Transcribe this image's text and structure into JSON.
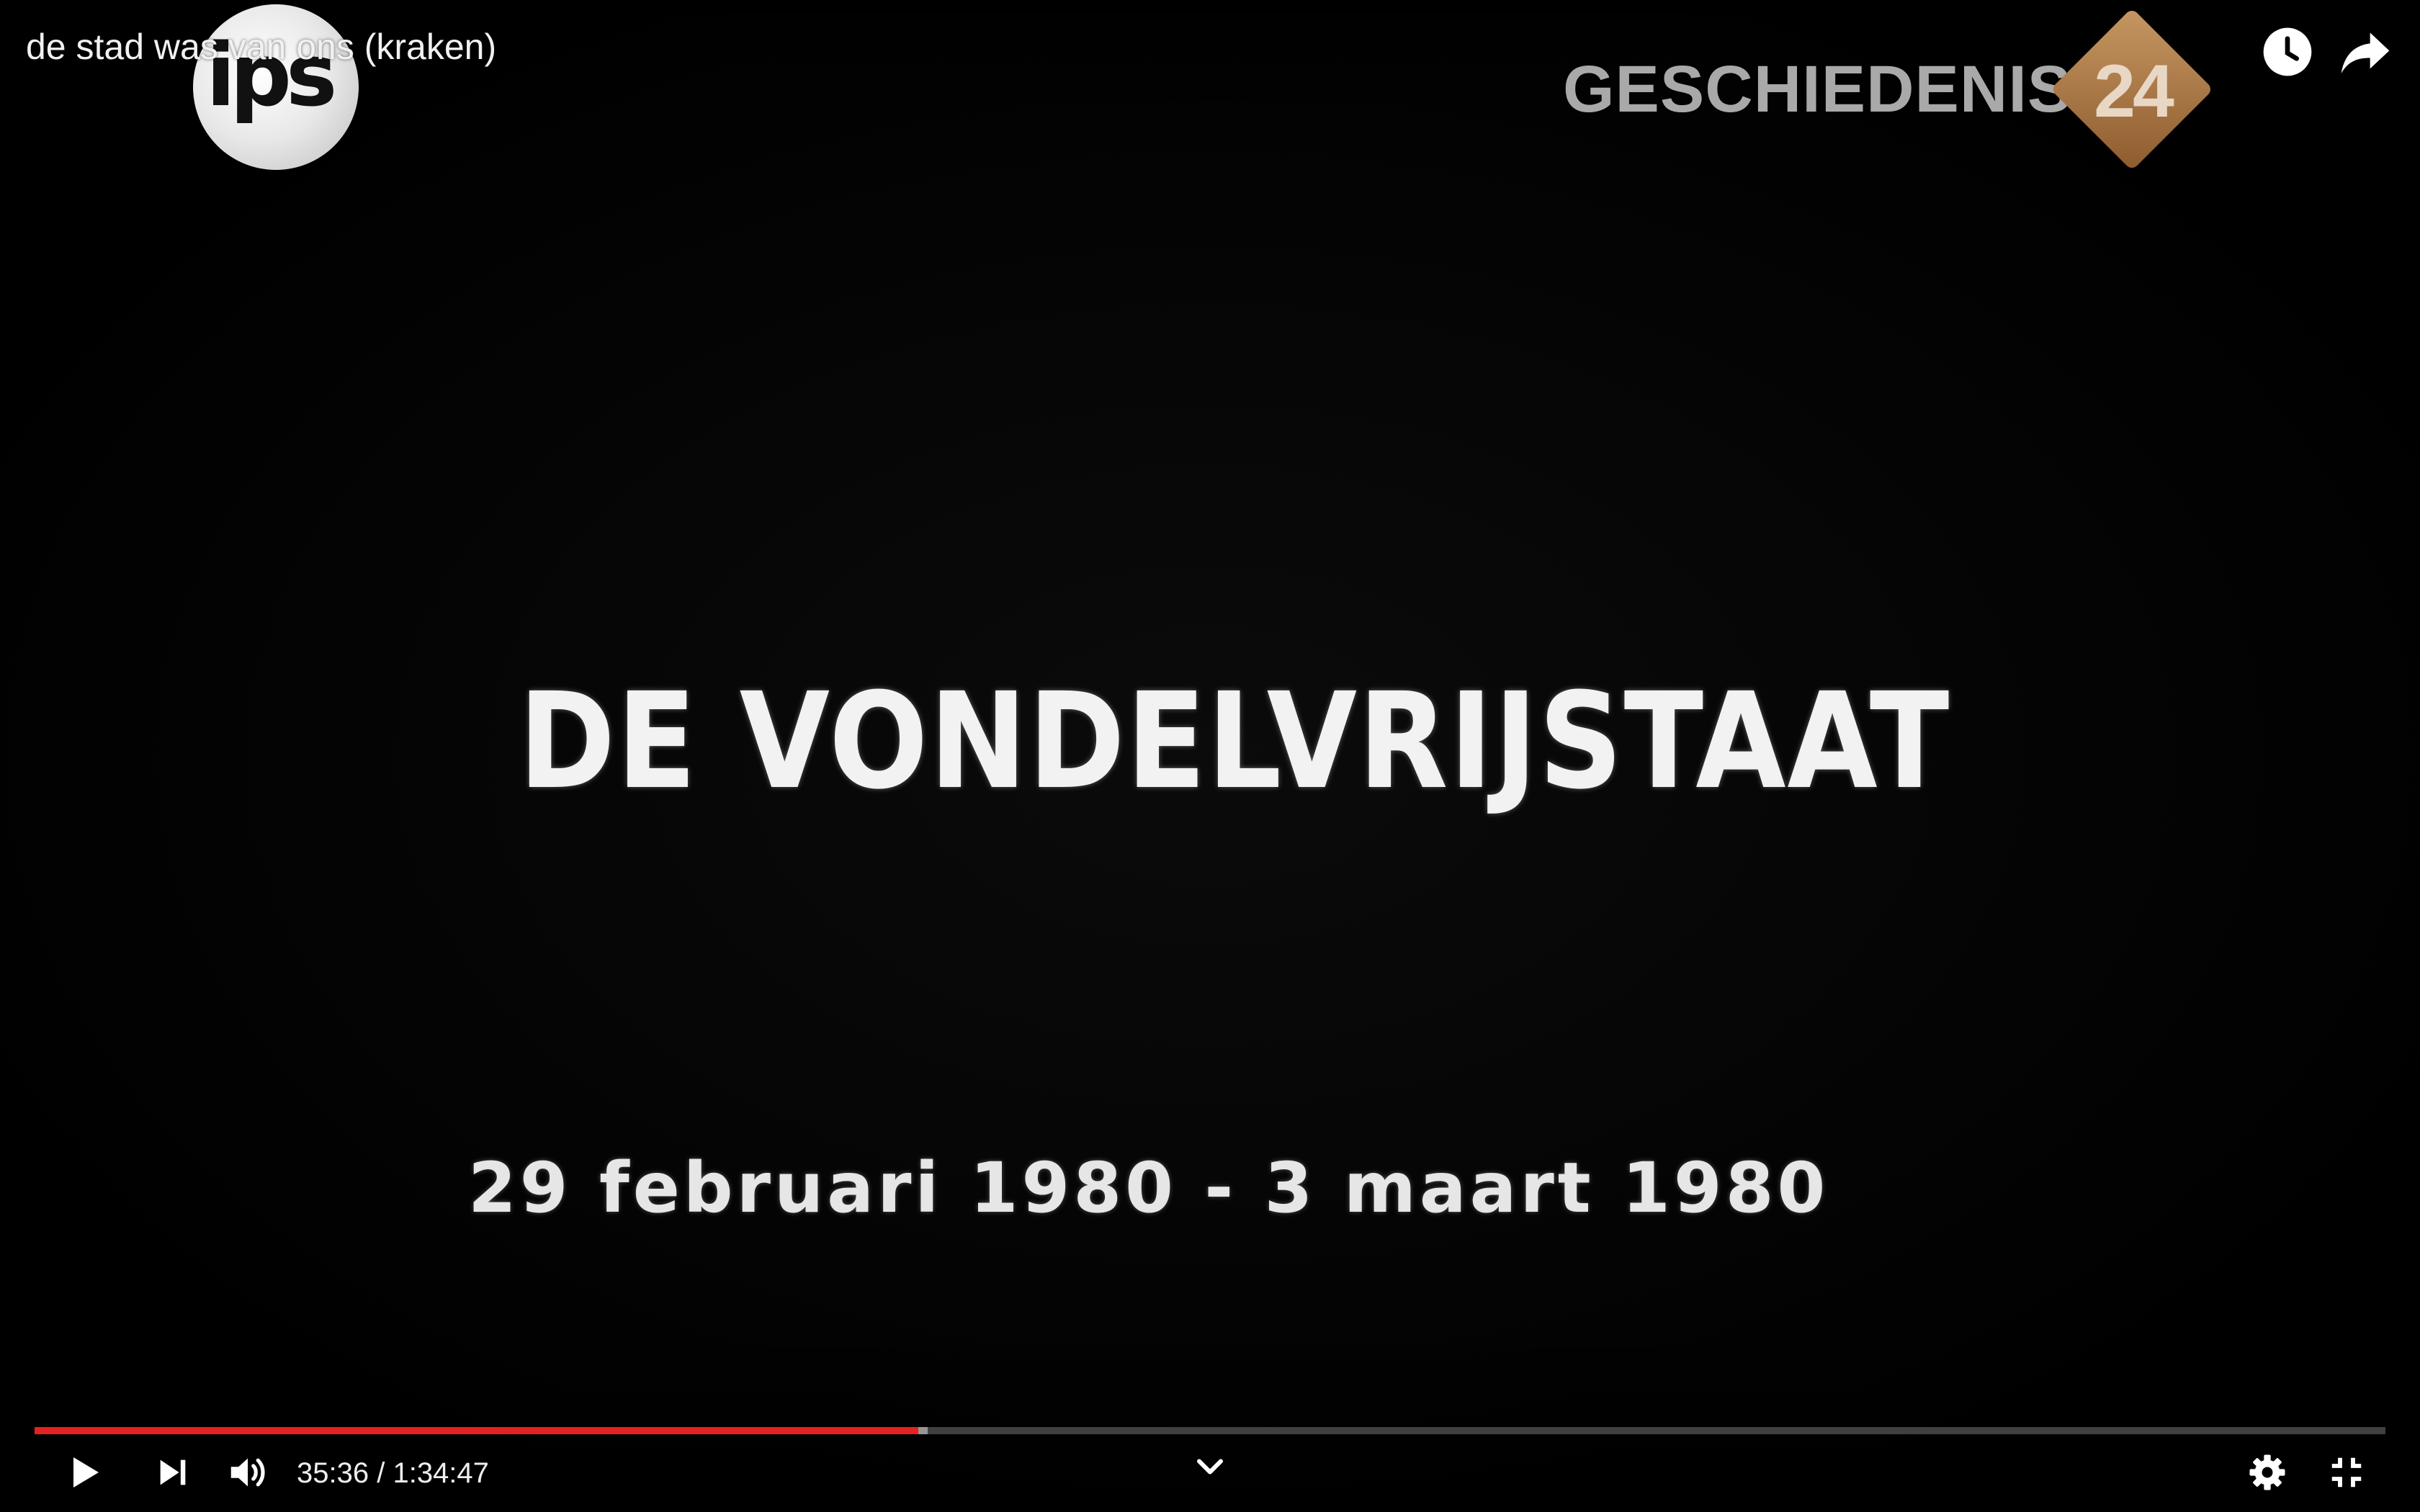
{
  "video": {
    "title": "de stad was van ons (kraken)",
    "overlay_headline": "DE VONDELVRIJSTAAT",
    "overlay_dates": "29 februari 1980 - 3 maart 1980"
  },
  "logos": {
    "left": {
      "text": "ips"
    },
    "right": {
      "text": "GESCHIEDENIS",
      "number": "24"
    }
  },
  "top_actions": {
    "watch_later_icon": "clock-icon",
    "share_icon": "share-arrow-icon"
  },
  "player": {
    "current_time": "35:36",
    "separator": " / ",
    "duration": "1:34:47",
    "progress_fraction": 0.376,
    "buffered_fraction": 0.38,
    "progress_color": "#e5221f",
    "icons": {
      "play": "play-icon",
      "next": "next-icon",
      "volume": "volume-icon",
      "chevron": "chevron-down-icon",
      "settings": "gear-icon",
      "exit_fullscreen": "exit-fullscreen-icon"
    }
  }
}
